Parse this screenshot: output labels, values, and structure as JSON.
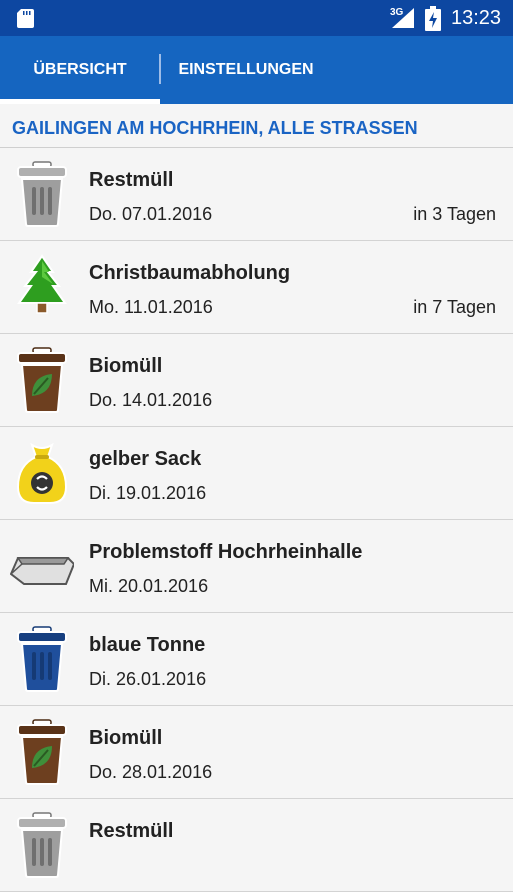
{
  "status_bar": {
    "network": "3G",
    "time": "13:23"
  },
  "tabs": [
    {
      "label": "ÜBERSICHT",
      "active": true
    },
    {
      "label": "EINSTELLUNGEN",
      "active": false
    }
  ],
  "location": "GAILINGEN AM HOCHRHEIN, ALLE STRASSEN",
  "pickups": [
    {
      "icon": "gray-trash-bin-icon",
      "title": "Restmüll",
      "date": "Do. 07.01.2016",
      "relative": "in 3 Tagen"
    },
    {
      "icon": "christmas-tree-icon",
      "title": "Christbaumabholung",
      "date": "Mo. 11.01.2016",
      "relative": "in 7 Tagen"
    },
    {
      "icon": "brown-bio-bin-icon",
      "title": "Biomüll",
      "date": "Do. 14.01.2016",
      "relative": ""
    },
    {
      "icon": "yellow-bag-icon",
      "title": "gelber Sack",
      "date": "Di. 19.01.2016",
      "relative": ""
    },
    {
      "icon": "skip-container-icon",
      "title": "Problemstoff Hochrheinhalle",
      "date": "Mi. 20.01.2016",
      "relative": ""
    },
    {
      "icon": "blue-paper-bin-icon",
      "title": "blaue Tonne",
      "date": "Di. 26.01.2016",
      "relative": ""
    },
    {
      "icon": "brown-bio-bin-icon",
      "title": "Biomüll",
      "date": "Do. 28.01.2016",
      "relative": ""
    },
    {
      "icon": "gray-trash-bin-icon",
      "title": "Restmüll",
      "date": "",
      "relative": ""
    }
  ],
  "colors": {
    "status_bar": "#0d47a1",
    "tab_bar": "#1565c0",
    "location_text": "#1a64c4",
    "restmuell": "#9e9e9e",
    "biomuell": "#6d3f1f",
    "gelber_sack": "#f2d21a",
    "blaue_tonne": "#1f4f9c",
    "christbaum": "#2e9e1f"
  }
}
